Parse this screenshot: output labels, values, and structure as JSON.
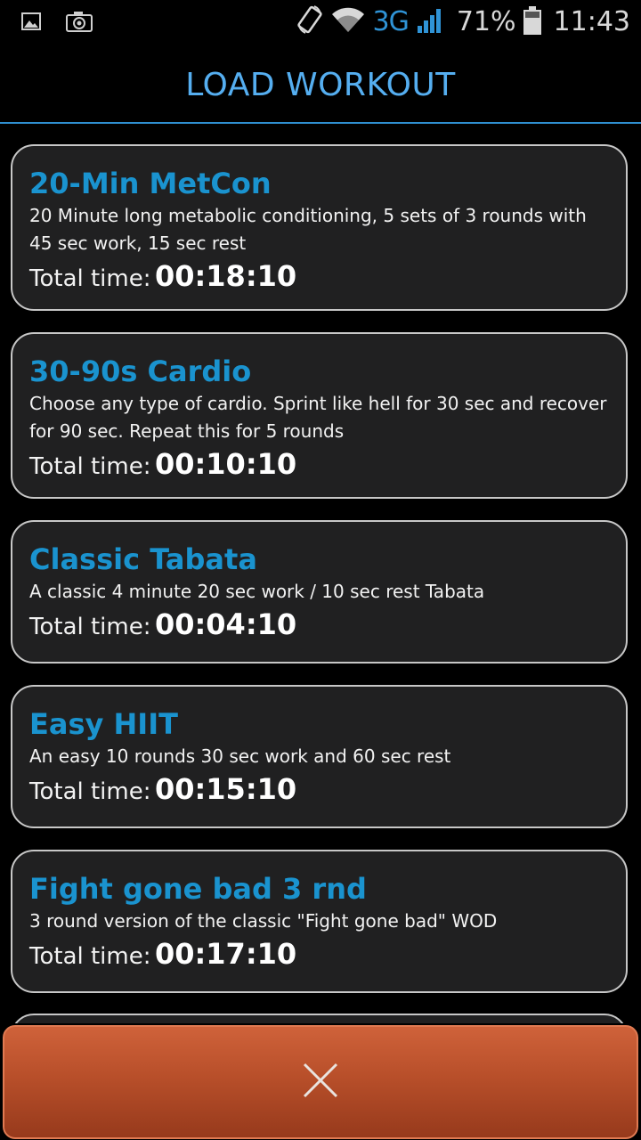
{
  "status_bar": {
    "network": "3G",
    "battery": "71%",
    "time": "11:43",
    "icons": [
      "gallery-icon",
      "camera-icon",
      "screen-rotation-icon",
      "wifi-icon",
      "signal-icon",
      "battery-icon"
    ]
  },
  "header": {
    "title": "LOAD WORKOUT"
  },
  "total_label": "Total time:",
  "workouts": [
    {
      "title": "20-Min MetCon",
      "description": "20 Minute long metabolic conditioning, 5 sets of 3 rounds with 45 sec work, 15 sec rest",
      "total_label": "Total time:",
      "total_time": "00:18:10"
    },
    {
      "title": "30-90s Cardio",
      "description": "Choose any type of cardio. Sprint like hell for 30 sec and recover for 90 sec. Repeat this for 5 rounds",
      "total_label": "Total time:",
      "total_time": "00:10:10"
    },
    {
      "title": "Classic Tabata",
      "description": "A classic 4 minute 20 sec work / 10 sec rest Tabata",
      "total_label": "Total time:",
      "total_time": "00:04:10"
    },
    {
      "title": "Easy HIIT",
      "description": "An easy 10 rounds 30 sec work and 60 sec rest",
      "total_label": "Total time:",
      "total_time": "00:15:10"
    },
    {
      "title": "Fight gone bad 3 rnd",
      "description": "3 round version of the classic \"Fight gone bad\" WOD",
      "total_label": "Total time:",
      "total_time": "00:17:10"
    }
  ],
  "close_button": {
    "icon": "close-icon"
  },
  "colors": {
    "accent": "#1a93cf",
    "header_title": "#55aef0",
    "close_bar": "#b84f2a",
    "card_bg": "#202021"
  }
}
